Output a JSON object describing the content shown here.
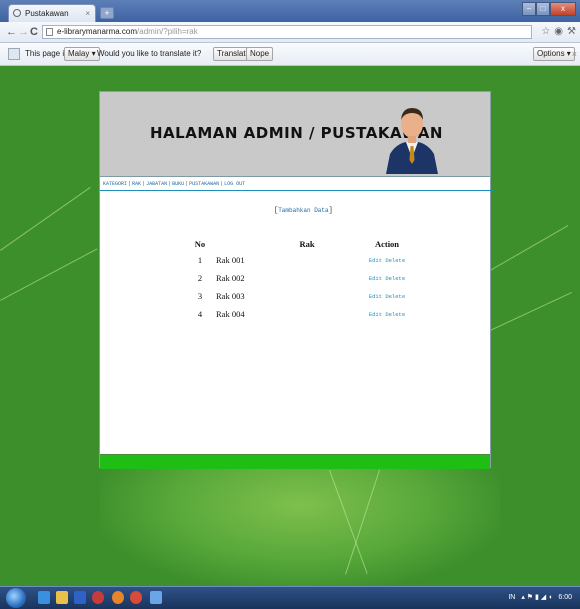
{
  "browser": {
    "tab_title": "Pustakawan",
    "tab_close": "×",
    "new_tab": "+",
    "url_domain": "e-librarymanarma.com",
    "url_path": "/admin/?pilih=rak",
    "back_icon": "←",
    "forward_icon": "→",
    "reload_icon": "C",
    "star_icon": "☆"
  },
  "translate_bar": {
    "text1": "This page is in",
    "language": "Malay",
    "text2": "Would you like to translate it?",
    "translate_label": "Translate",
    "nope_label": "Nope",
    "options_label": "Options"
  },
  "page": {
    "banner_title": "HALAMAN ADMIN / PUSTAKAWAN",
    "menu": [
      "KATEGORI",
      "RAK",
      "JABATAN",
      "BUKU",
      "PUSTAKAWAN",
      "LOG OUT"
    ],
    "add_link": "Tambahkan Data",
    "table": {
      "headers": [
        "No",
        "Rak",
        "Action"
      ],
      "rows": [
        {
          "no": "1",
          "name": "Rak 001",
          "edit": "Edit",
          "delete": "Delete"
        },
        {
          "no": "2",
          "name": "Rak 002",
          "edit": "Edit",
          "delete": "Delete"
        },
        {
          "no": "3",
          "name": "Rak 003",
          "edit": "Edit",
          "delete": "Delete"
        },
        {
          "no": "4",
          "name": "Rak 004",
          "edit": "Edit",
          "delete": "Delete"
        }
      ]
    }
  },
  "taskbar": {
    "tray_lang": "IN",
    "clock": "6:00"
  },
  "colors": {
    "link": "#1e6aa0",
    "footer_green": "#1fbe15",
    "desktop_green": "#3d8f2c"
  }
}
